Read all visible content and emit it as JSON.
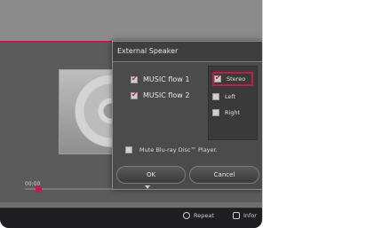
{
  "dialog": {
    "title": "External Speaker",
    "options": [
      {
        "label": "MUSIC flow 1",
        "checked": true
      },
      {
        "label": "MUSIC flow 2",
        "checked": true
      }
    ],
    "channels": [
      {
        "label": "Stereo",
        "checked": true,
        "selected": true
      },
      {
        "label": "Left",
        "checked": false
      },
      {
        "label": "Right",
        "checked": false
      }
    ],
    "mute_label": "Mute Blu-ray Disc™ Player.",
    "ok_label": "OK",
    "cancel_label": "Cancel"
  },
  "player": {
    "time": "00:00",
    "progress": 0
  },
  "bottom_bar": {
    "repeat_label": "Repeat",
    "info_label": "Infor"
  },
  "colors": {
    "accent": "#c21c4c"
  }
}
